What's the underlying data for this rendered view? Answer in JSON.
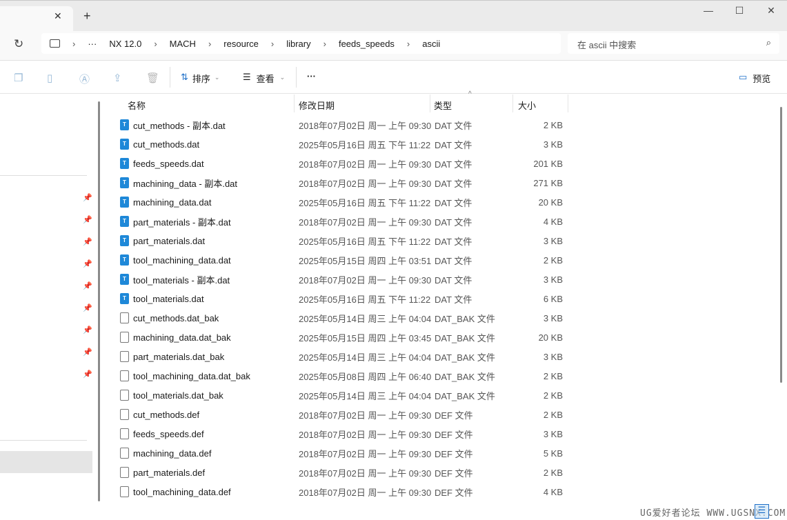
{
  "window": {
    "new_tab": "+",
    "close_tab": "✕",
    "minimize": "—",
    "maximize": "☐",
    "close": "✕"
  },
  "breadcrumb": [
    "NX 12.0",
    "MACH",
    "resource",
    "library",
    "feeds_speeds",
    "ascii"
  ],
  "breadcrumb_more": "···",
  "search": {
    "placeholder": "在 ascii 中搜索"
  },
  "toolbar": {
    "sort": "排序",
    "view": "查看",
    "more": "···",
    "preview": "预览"
  },
  "columns": {
    "name": "名称",
    "date": "修改日期",
    "type": "类型",
    "size": "大小"
  },
  "files": [
    {
      "name": "cut_methods - 副本.dat",
      "date": "2018年07月02日 周一 上午 09:30",
      "type": "DAT 文件",
      "size": "2 KB",
      "icon": "text"
    },
    {
      "name": "cut_methods.dat",
      "date": "2025年05月16日 周五 下午 11:22",
      "type": "DAT 文件",
      "size": "3 KB",
      "icon": "text"
    },
    {
      "name": "feeds_speeds.dat",
      "date": "2018年07月02日 周一 上午 09:30",
      "type": "DAT 文件",
      "size": "201 KB",
      "icon": "text"
    },
    {
      "name": "machining_data - 副本.dat",
      "date": "2018年07月02日 周一 上午 09:30",
      "type": "DAT 文件",
      "size": "271 KB",
      "icon": "text"
    },
    {
      "name": "machining_data.dat",
      "date": "2025年05月16日 周五 下午 11:22",
      "type": "DAT 文件",
      "size": "20 KB",
      "icon": "text"
    },
    {
      "name": "part_materials - 副本.dat",
      "date": "2018年07月02日 周一 上午 09:30",
      "type": "DAT 文件",
      "size": "4 KB",
      "icon": "text"
    },
    {
      "name": "part_materials.dat",
      "date": "2025年05月16日 周五 下午 11:22",
      "type": "DAT 文件",
      "size": "3 KB",
      "icon": "text"
    },
    {
      "name": "tool_machining_data.dat",
      "date": "2025年05月15日 周四 上午 03:51",
      "type": "DAT 文件",
      "size": "2 KB",
      "icon": "text"
    },
    {
      "name": "tool_materials - 副本.dat",
      "date": "2018年07月02日 周一 上午 09:30",
      "type": "DAT 文件",
      "size": "3 KB",
      "icon": "text"
    },
    {
      "name": "tool_materials.dat",
      "date": "2025年05月16日 周五 下午 11:22",
      "type": "DAT 文件",
      "size": "6 KB",
      "icon": "text"
    },
    {
      "name": "cut_methods.dat_bak",
      "date": "2025年05月14日 周三 上午 04:04",
      "type": "DAT_BAK 文件",
      "size": "3 KB",
      "icon": "file"
    },
    {
      "name": "machining_data.dat_bak",
      "date": "2025年05月15日 周四 上午 03:45",
      "type": "DAT_BAK 文件",
      "size": "20 KB",
      "icon": "file"
    },
    {
      "name": "part_materials.dat_bak",
      "date": "2025年05月14日 周三 上午 04:04",
      "type": "DAT_BAK 文件",
      "size": "3 KB",
      "icon": "file"
    },
    {
      "name": "tool_machining_data.dat_bak",
      "date": "2025年05月08日 周四 上午 06:40",
      "type": "DAT_BAK 文件",
      "size": "2 KB",
      "icon": "file"
    },
    {
      "name": "tool_materials.dat_bak",
      "date": "2025年05月14日 周三 上午 04:04",
      "type": "DAT_BAK 文件",
      "size": "2 KB",
      "icon": "file"
    },
    {
      "name": "cut_methods.def",
      "date": "2018年07月02日 周一 上午 09:30",
      "type": "DEF 文件",
      "size": "2 KB",
      "icon": "file"
    },
    {
      "name": "feeds_speeds.def",
      "date": "2018年07月02日 周一 上午 09:30",
      "type": "DEF 文件",
      "size": "3 KB",
      "icon": "file"
    },
    {
      "name": "machining_data.def",
      "date": "2018年07月02日 周一 上午 09:30",
      "type": "DEF 文件",
      "size": "5 KB",
      "icon": "file"
    },
    {
      "name": "part_materials.def",
      "date": "2018年07月02日 周一 上午 09:30",
      "type": "DEF 文件",
      "size": "2 KB",
      "icon": "file"
    },
    {
      "name": "tool_machining_data.def",
      "date": "2018年07月02日 周一 上午 09:30",
      "type": "DEF 文件",
      "size": "4 KB",
      "icon": "file"
    }
  ],
  "watermark": "UG爱好者论坛 WWW.UGSNX.COM"
}
